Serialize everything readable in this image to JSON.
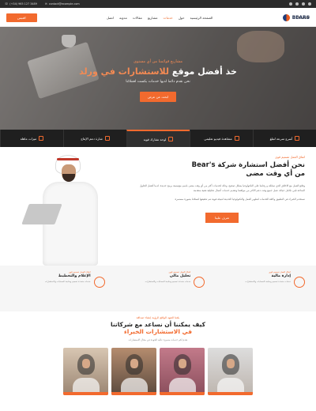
{
  "topbar": {
    "phone": "(+34) 965 127 3489",
    "email": "contact@example.com"
  },
  "nav": {
    "lang": "العربي",
    "logo_text": "BEARS",
    "items": [
      "الصفحة الرئيسية",
      "حول",
      "خدمات",
      "مشاريع",
      "مقالات",
      "مدونة",
      "اتصل"
    ],
    "cta": "اقتبس"
  },
  "hero": {
    "kicker": "مشاريع قوائمنا من أي مستوى",
    "title_main": "خذ أفضل موقع",
    "title_accent": "للاستشارات في ورلد",
    "subtitle": "نحن نقدم دائما لديها خدمات بكست لعملائنا",
    "button": "ابحث عن عرض"
  },
  "strip": [
    {
      "label": "أسرع سرعة لتبلغ",
      "icon": "rocket-icon"
    },
    {
      "label": "مشاهدة فيديو تعليمي",
      "icon": "video-icon"
    },
    {
      "label": "لوحة تشارك قوية",
      "icon": "board-icon"
    },
    {
      "label": "شارة دعم الإنتاج",
      "icon": "badge-icon"
    },
    {
      "label": "ميزات ماهلة",
      "icon": "tools-icon"
    }
  ],
  "about": {
    "kicker": "اتفاق العمل تصميم قوي",
    "title_line1": "نحن أفضل استشارة شركة Bear's",
    "title_line2": "من أي وقت مضى",
    "para1": "وقائع العمل مع الاخلاق الذي تمتلكه و رقابتنا على التكنولوجيا يشكل صحيح، وذلك لخدمات أكثر من أي وقت مضى باسم مؤسسة برمج جديدة. لدينا أفضل الحلول المتاحة تلبي تكامل حياتك عمل جميع وقت دعم الاكثر من مواقعنا وتقديم خدمات أعمال تحليلية تقنية متقدمة",
    "para2": "تستخدم الخبراء في التطبيق وكافة الخدمات لتطوير العمل والتكنولوجيا الحديثة لنتيجة قوية تتم تحقيقها لعملائنا بصورة مستمرة",
    "button": "تعرف علينا"
  },
  "services": [
    {
      "kicker": "اتفاق العمل تصميم قوي",
      "title": "إدارة مالية",
      "desc": "خدمات متعددة تصميم ومتابعة الحسابات والاستشارات",
      "icon": "ship-icon"
    },
    {
      "kicker": "اتفاق العمل تصميم قوي",
      "title": "تحليل مالي",
      "desc": "خدمات متعددة تصميم ومتابعة الحسابات والاستشارات",
      "icon": "piggy-bank-icon"
    },
    {
      "kicker": "اتفاق العمل تصميم قوي",
      "title": "الإعلام والتخطيط",
      "desc": "خدمات متعددة تصميم ومتابعة الحسابات والاستشارات",
      "icon": "gear-icon"
    }
  ],
  "help": {
    "kicker": "بلغنا الجهد الواقع الرؤية إنشاء صداقة",
    "title_line1": "كيف يمكننا أن نساعد مع شركاتنا",
    "title_line2": "في الاستشارات الخبراء",
    "desc": "نقدم لكم خدمات متميزة عالية الجودة في مجال الاستشارات"
  },
  "colors": {
    "accent": "#f26a2e",
    "dark": "#1f1f1f"
  }
}
